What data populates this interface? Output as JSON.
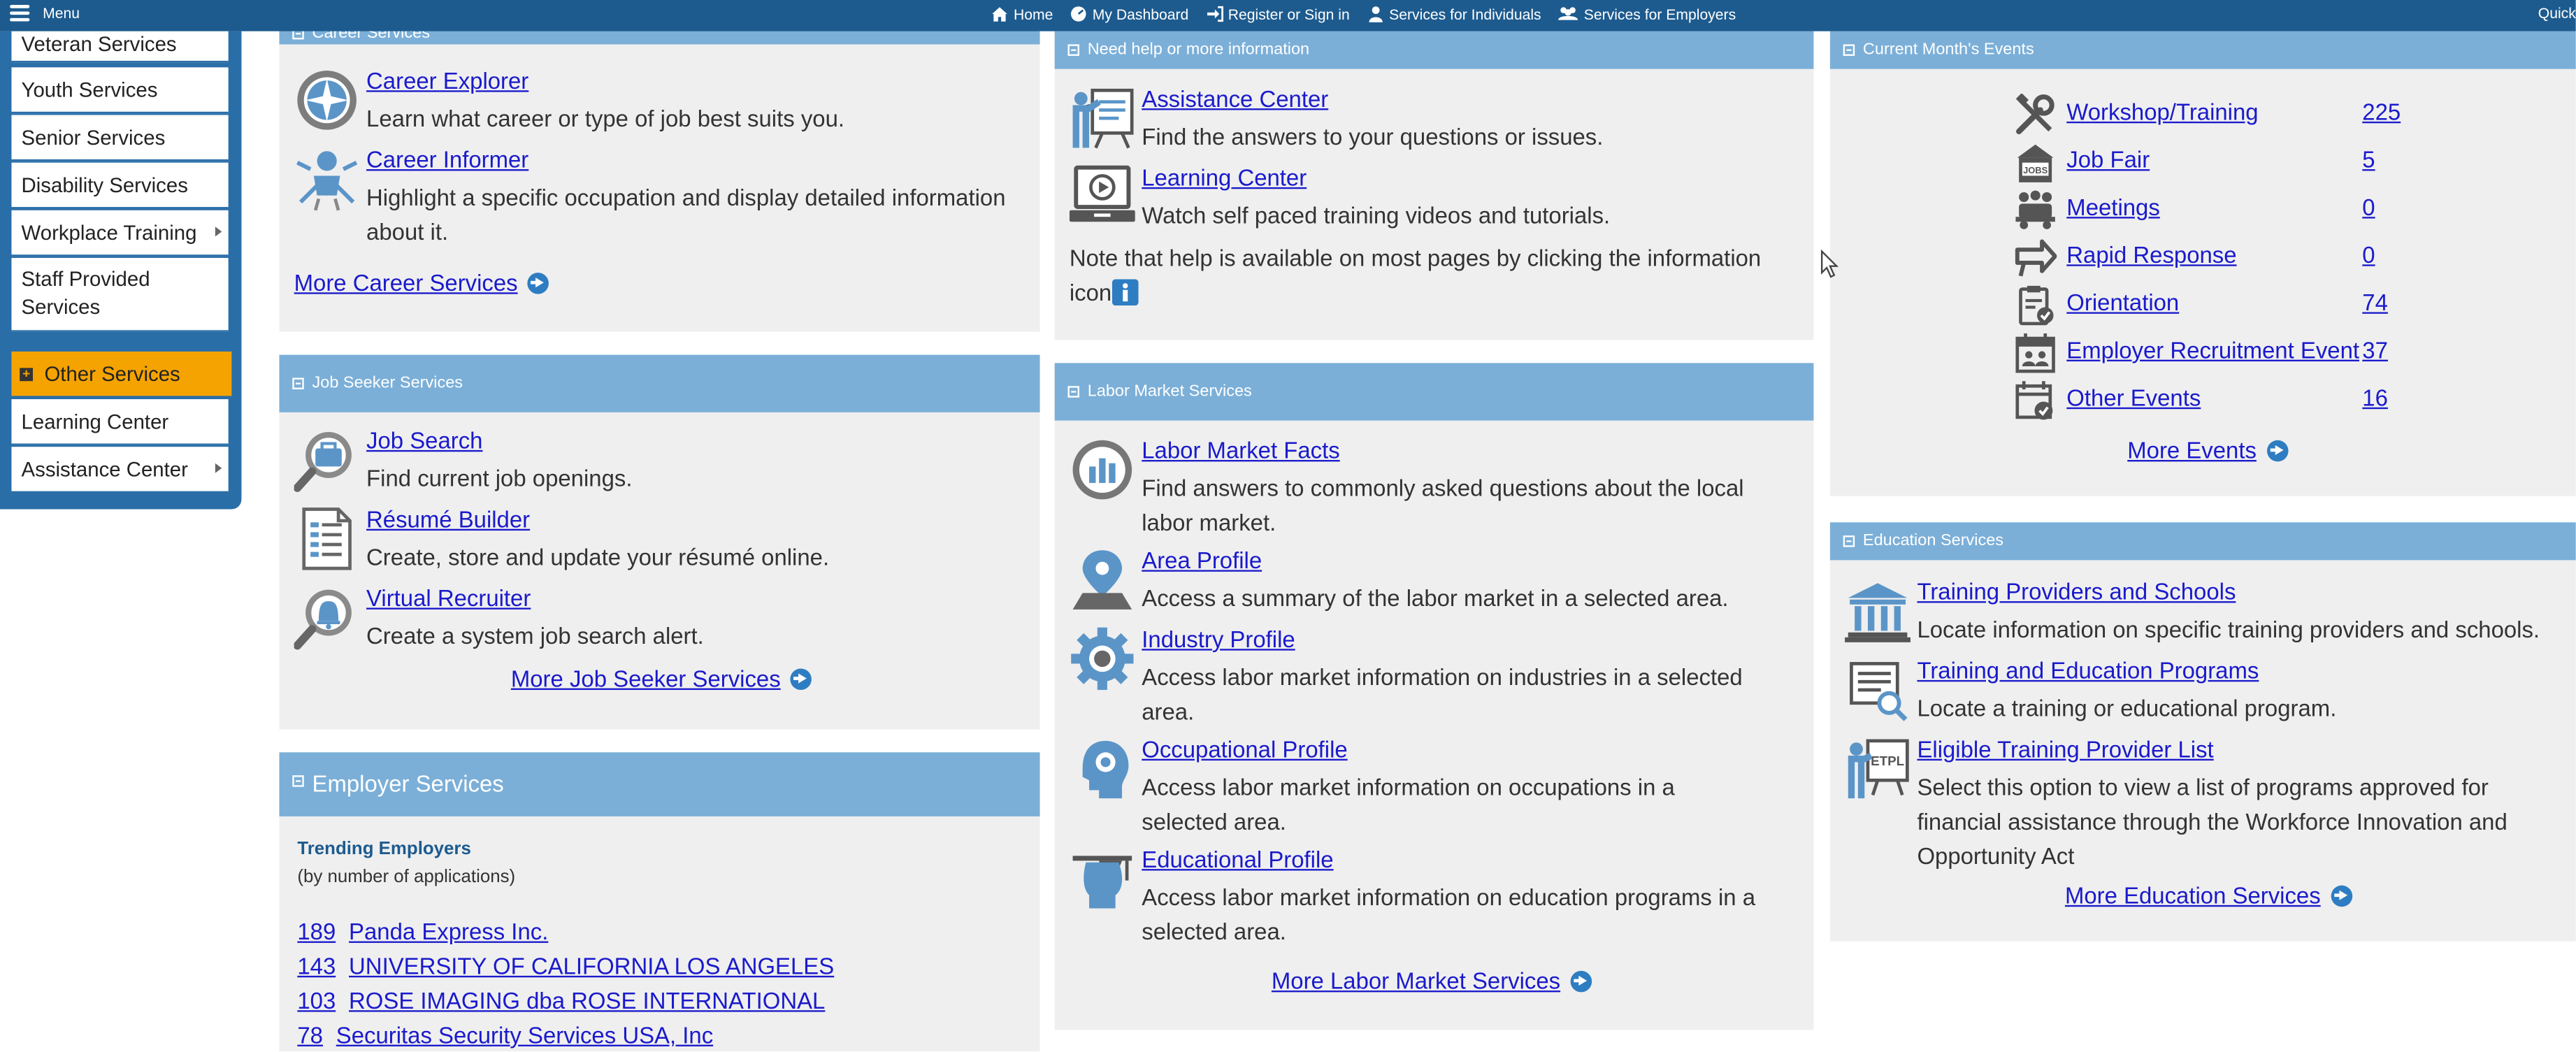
{
  "topbar": {
    "menu_label": "Menu",
    "links": [
      "Home",
      "My Dashboard",
      "Register or Sign in",
      "Services for Individuals",
      "Services for Employers"
    ],
    "quick": "Quick S"
  },
  "left_menu": {
    "items": [
      "Veteran Services",
      "Youth Services",
      "Senior Services",
      "Disability Services",
      "Workplace Training",
      "Staff Provided Services"
    ],
    "other_label": "Other Services",
    "other_items": [
      "Learning Center",
      "Assistance Center"
    ]
  },
  "career": {
    "header": "Career Services",
    "items": [
      {
        "title": "Career Explorer",
        "desc": "Learn what career or type of job best suits you."
      },
      {
        "title": "Career Informer",
        "desc": "Highlight a specific occupation and display detailed information about it."
      }
    ],
    "more": "More Career Services"
  },
  "jobseeker": {
    "header": "Job Seeker Services",
    "items": [
      {
        "title": "Job Search",
        "desc": "Find current job openings."
      },
      {
        "title": "Résumé Builder",
        "desc": "Create, store and update your résumé online."
      },
      {
        "title": "Virtual Recruiter",
        "desc": "Create a system job search alert."
      }
    ],
    "more": "More Job Seeker Services"
  },
  "employer": {
    "header": "Employer Services",
    "trending_title": "Trending Employers",
    "trending_sub": "(by number of applications)",
    "rows": [
      {
        "count": "189",
        "name": "Panda Express Inc."
      },
      {
        "count": "143",
        "name": "UNIVERSITY OF CALIFORNIA LOS ANGELES"
      },
      {
        "count": "103",
        "name": "ROSE IMAGING dba ROSE INTERNATIONAL"
      },
      {
        "count": "78",
        "name": "Securitas Security Services USA, Inc"
      }
    ]
  },
  "help": {
    "header": "Need help or more information",
    "items": [
      {
        "title": "Assistance Center",
        "desc": "Find the answers to your questions or issues."
      },
      {
        "title": "Learning Center",
        "desc": "Watch self paced training videos and tutorials."
      }
    ],
    "note": "Note that help is available on most pages by clicking the information icon"
  },
  "labor": {
    "header": "Labor Market Services",
    "items": [
      {
        "title": "Labor Market Facts",
        "desc": "Find answers to commonly asked questions about the local labor market."
      },
      {
        "title": "Area Profile",
        "desc": "Access a summary of the labor market in a selected area."
      },
      {
        "title": "Industry Profile",
        "desc": "Access labor market information on industries in a selected area."
      },
      {
        "title": "Occupational Profile",
        "desc": "Access labor market information on occupations in a selected area."
      },
      {
        "title": "Educational Profile",
        "desc": "Access labor market information on education programs in a selected area."
      }
    ],
    "more": "More Labor Market Services"
  },
  "events": {
    "header": "Current Month's Events",
    "rows": [
      {
        "label": "Workshop/Training",
        "count": "225"
      },
      {
        "label": "Job Fair",
        "count": "5"
      },
      {
        "label": "Meetings",
        "count": "0"
      },
      {
        "label": "Rapid Response",
        "count": "0"
      },
      {
        "label": "Orientation",
        "count": "74"
      },
      {
        "label": "Employer Recruitment Event",
        "count": "37"
      },
      {
        "label": "Other Events",
        "count": "16"
      }
    ],
    "more": "More Events",
    "jobfair_icon_text": "JOBS"
  },
  "education": {
    "header": "Education Services",
    "items": [
      {
        "title": "Training Providers and Schools",
        "desc": "Locate information on specific training providers and schools."
      },
      {
        "title": "Training and Education Programs",
        "desc": "Locate a training or educational program."
      },
      {
        "title": "Eligible Training Provider List",
        "desc": "Select this option to view a list of programs approved for financial assistance through the Workforce Innovation and Opportunity Act"
      }
    ],
    "more": "More Education Services",
    "etpl_icon_text": "ETPL"
  },
  "colors": {
    "nav": "#1d5b8f",
    "panel_header": "#7bafd8",
    "panel_bg": "#efefef",
    "link": "#1a1acc",
    "other_services": "#f5a300"
  }
}
